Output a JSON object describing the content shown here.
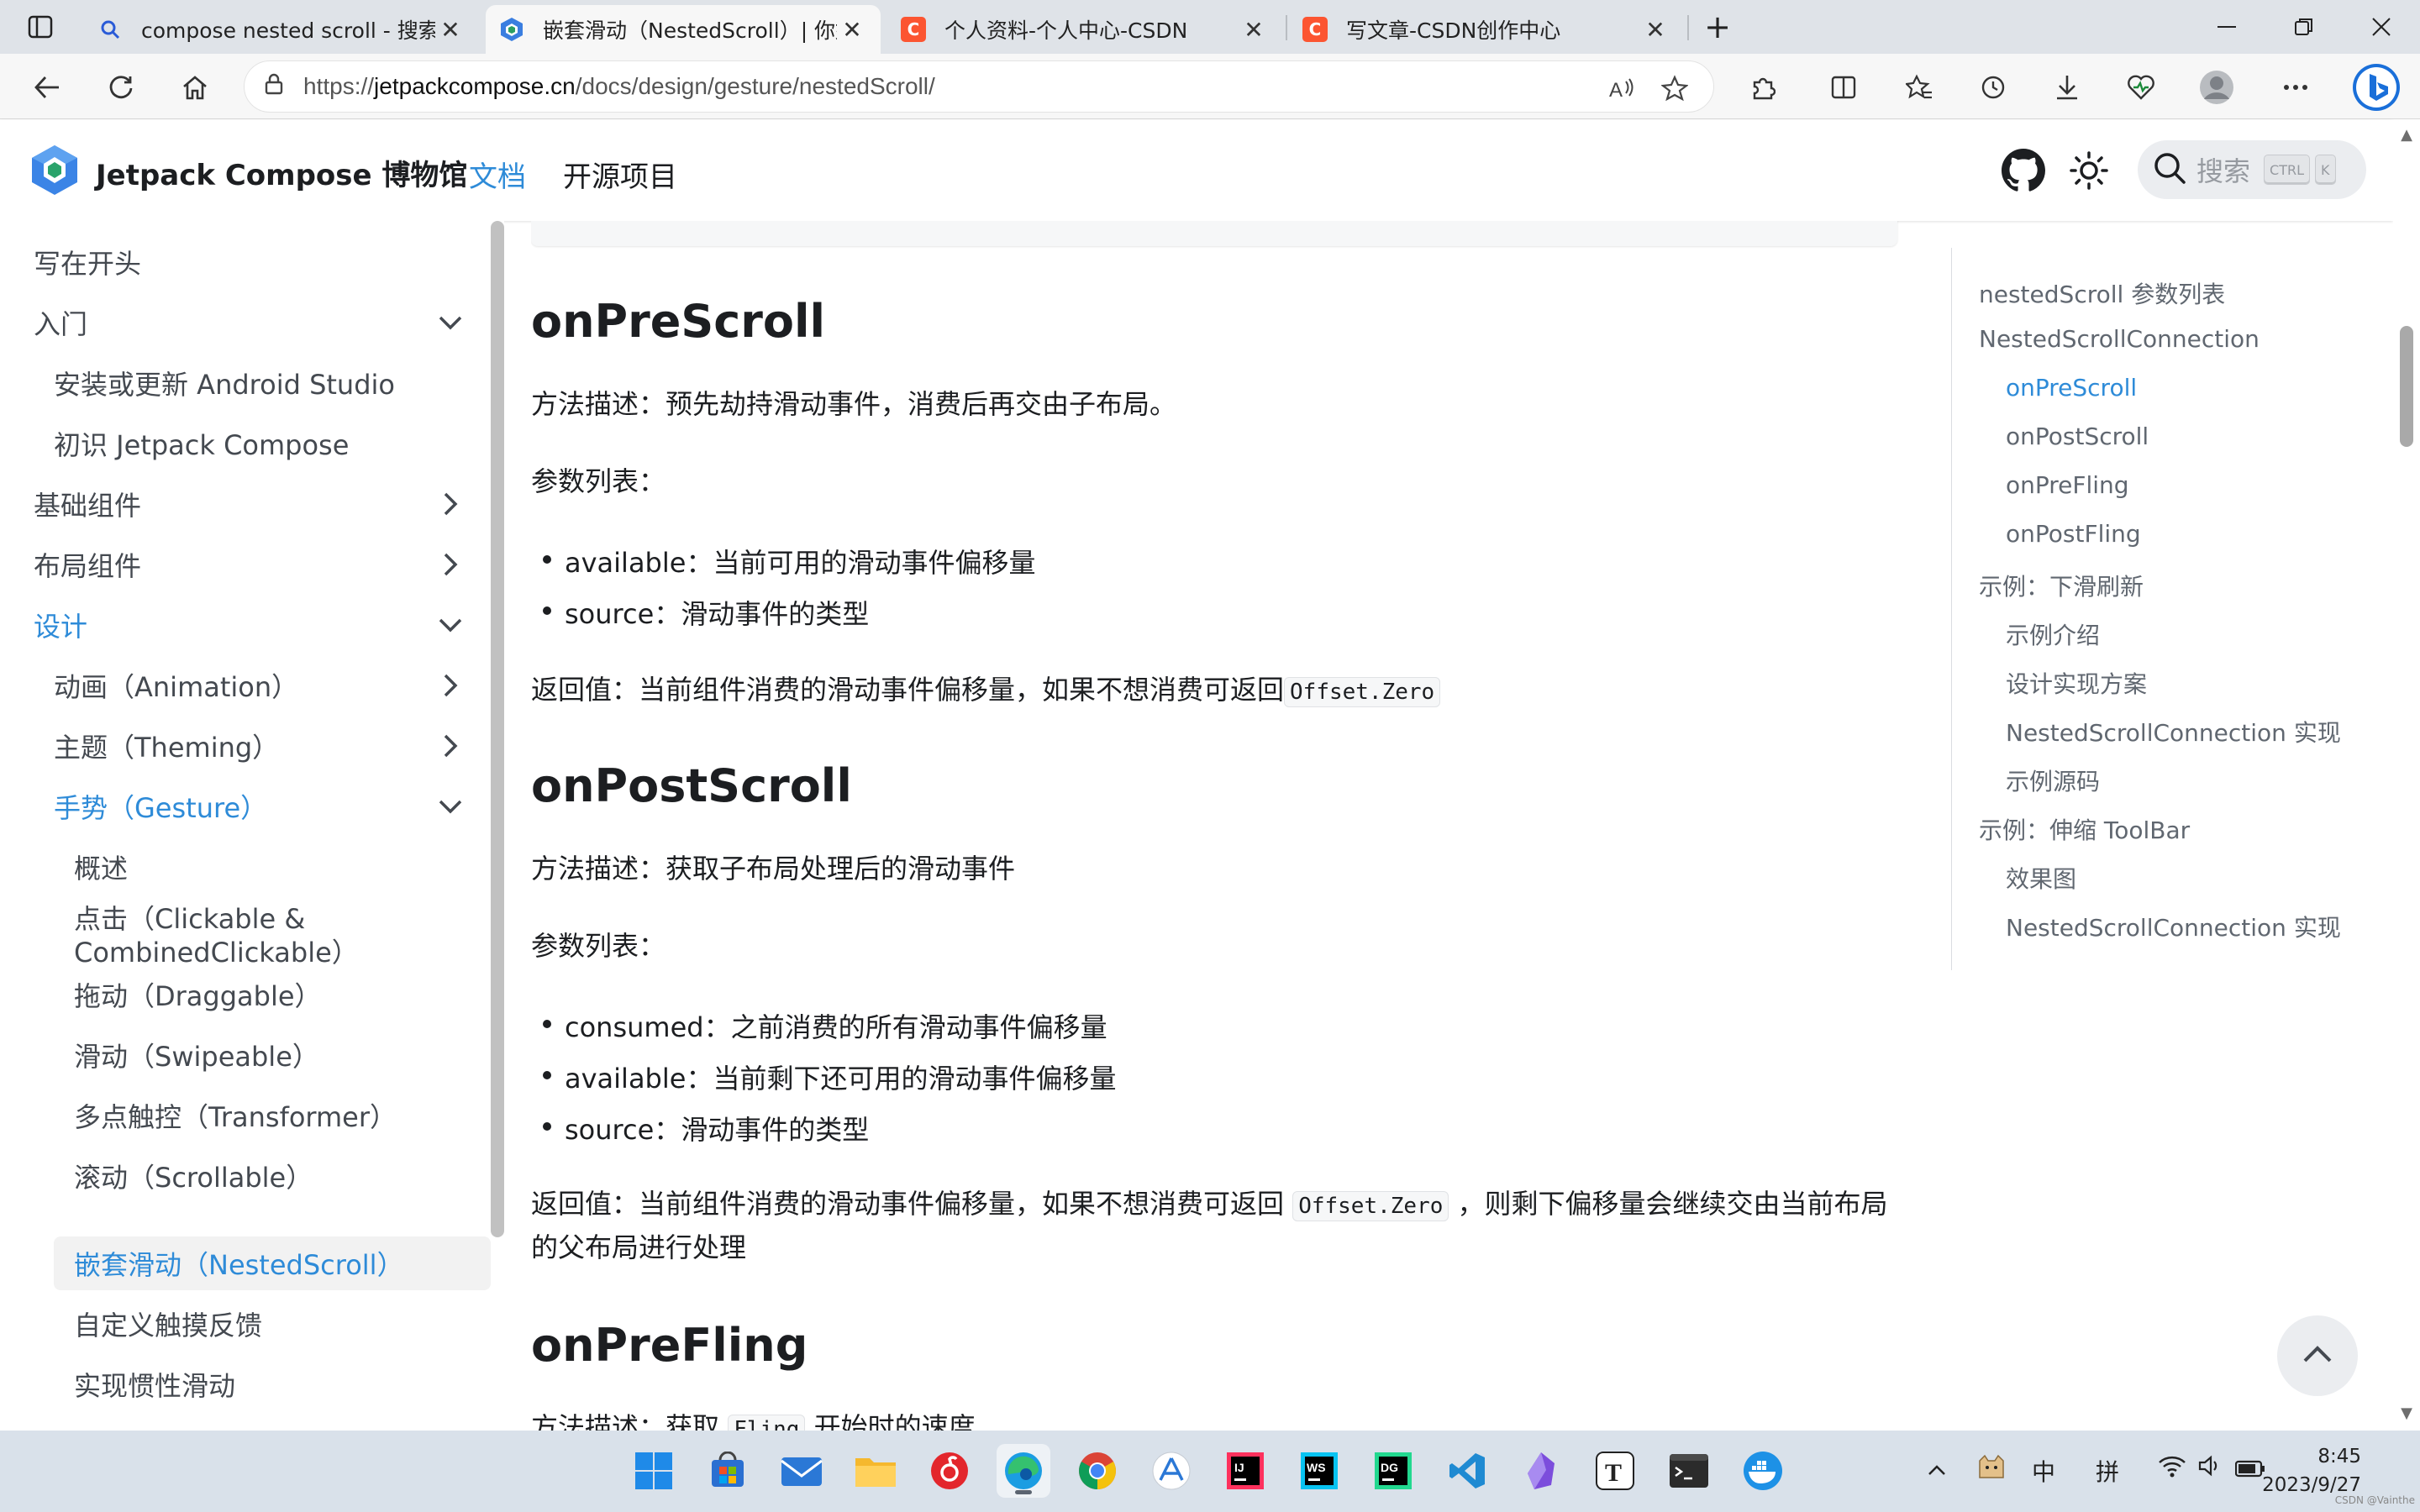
{
  "browser": {
    "tabs": [
      {
        "title": "compose nested scroll - 搜索",
        "icon": "search-icon",
        "active": false
      },
      {
        "title": "嵌套滑动（NestedScroll）| 你好",
        "icon": "jetpack-compose-icon",
        "active": true
      },
      {
        "title": "个人资料-个人中心-CSDN",
        "icon": "csdn-icon",
        "active": false
      },
      {
        "title": "写文章-CSDN创作中心",
        "icon": "csdn-icon",
        "active": false
      }
    ],
    "url_prefix": "https://",
    "url_host": "jetpackcompose.cn",
    "url_path": "/docs/design/gesture/nestedScroll/",
    "colors": {
      "csdn": "#fc5531",
      "accent": "#2e8bd8"
    }
  },
  "site": {
    "name": "Jetpack Compose 博物馆",
    "nav": [
      {
        "label": "文档",
        "active": true
      },
      {
        "label": "开源项目",
        "active": false
      }
    ],
    "search_placeholder": "搜索",
    "kbd_ctrl": "CTRL",
    "kbd_k": "K"
  },
  "sidebar": {
    "items": [
      {
        "label": "写在开头",
        "level": 0,
        "chevron": "none"
      },
      {
        "label": "入门",
        "level": 0,
        "chevron": "down"
      },
      {
        "label": "安装或更新 Android Studio",
        "level": 1,
        "chevron": "none"
      },
      {
        "label": "初识 Jetpack Compose",
        "level": 1,
        "chevron": "none"
      },
      {
        "label": "基础组件",
        "level": 0,
        "chevron": "right"
      },
      {
        "label": "布局组件",
        "level": 0,
        "chevron": "right"
      },
      {
        "label": "设计",
        "level": 0,
        "chevron": "down",
        "highlight": true
      },
      {
        "label": "动画（Animation）",
        "level": 1,
        "chevron": "right"
      },
      {
        "label": "主题（Theming）",
        "level": 1,
        "chevron": "right"
      },
      {
        "label": "手势（Gesture）",
        "level": 1,
        "chevron": "down",
        "highlight": true
      },
      {
        "label": "概述",
        "level": 2,
        "chevron": "none"
      },
      {
        "label": "点击（Clickable &",
        "label2": "CombinedClickable）",
        "level": 2,
        "chevron": "none"
      },
      {
        "label": "拖动（Draggable）",
        "level": 2,
        "chevron": "none"
      },
      {
        "label": "滑动（Swipeable）",
        "level": 2,
        "chevron": "none"
      },
      {
        "label": "多点触控（Transformer）",
        "level": 2,
        "chevron": "none"
      },
      {
        "label": "滚动（Scrollable）",
        "level": 2,
        "chevron": "none"
      },
      {
        "label": "嵌套滑动（NestedScroll）",
        "level": 2,
        "chevron": "none",
        "highlight": true,
        "current": true
      },
      {
        "label": "自定义触摸反馈",
        "level": 2,
        "chevron": "none"
      },
      {
        "label": "实现惯性滑动",
        "level": 2,
        "chevron": "none"
      }
    ]
  },
  "content": {
    "pre_scroll": {
      "heading": "onPreScroll",
      "desc": "方法描述：预先劫持滑动事件，消费后再交由子布局。",
      "params_title": "参数列表：",
      "params": [
        {
          "name": "available",
          "text": "：当前可用的滑动事件偏移量"
        },
        {
          "name": "source",
          "text": "：滑动事件的类型"
        }
      ],
      "ret_text": "返回值：当前组件消费的滑动事件偏移量，如果不想消费可返回",
      "ret_code": "Offset.Zero"
    },
    "post_scroll": {
      "heading": "onPostScroll",
      "desc": "方法描述：获取子布局处理后的滑动事件",
      "params_title": "参数列表：",
      "params": [
        {
          "name": "consumed",
          "text": "：之前消费的所有滑动事件偏移量"
        },
        {
          "name": "available",
          "text": "：当前剩下还可用的滑动事件偏移量"
        },
        {
          "name": "source",
          "text": "：滑动事件的类型"
        }
      ],
      "ret_text": "返回值：当前组件消费的滑动事件偏移量，如果不想消费可返回",
      "ret_code": "Offset.Zero",
      "ret_text2": "，则剩下偏移量会继续交由当前布局",
      "ret_line2": "的父布局进行处理"
    },
    "pre_fling": {
      "heading": "onPreFling",
      "desc_start": "方法描述：获取",
      "desc_code": "Fling",
      "desc_end": "开始时的速度"
    }
  },
  "toc": {
    "items": [
      {
        "label": "nestedScroll 参数列表",
        "level": 0
      },
      {
        "label": "NestedScrollConnection",
        "level": 0
      },
      {
        "label": "onPreScroll",
        "level": 1,
        "active": true
      },
      {
        "label": "onPostScroll",
        "level": 1
      },
      {
        "label": "onPreFling",
        "level": 1
      },
      {
        "label": "onPostFling",
        "level": 1
      },
      {
        "label": "示例：下滑刷新",
        "level": 0
      },
      {
        "label": "示例介绍",
        "level": 1
      },
      {
        "label": "设计实现方案",
        "level": 1
      },
      {
        "label": "NestedScrollConnection 实现",
        "level": 1
      },
      {
        "label": "示例源码",
        "level": 1
      },
      {
        "label": "示例：伸缩 ToolBar",
        "level": 0
      },
      {
        "label": "效果图",
        "level": 1
      },
      {
        "label": "NestedScrollConnection 实现",
        "level": 1
      }
    ]
  },
  "taskbar": {
    "apps": [
      "windows-start-icon",
      "microsoft-store-icon",
      "mail-icon",
      "file-explorer-icon",
      "netease-music-icon",
      "edge-icon",
      "chrome-icon",
      "app-store-icon",
      "intellij-idea-icon",
      "webstorm-icon",
      "datagrip-icon",
      "vscode-icon",
      "obsidian-icon",
      "typora-icon",
      "terminal-icon",
      "docker-icon"
    ],
    "ime_lang": "中",
    "ime_mode": "拼",
    "time": "8:45",
    "date": "2023/9/27",
    "watermark": "CSDN @Vainthe"
  }
}
